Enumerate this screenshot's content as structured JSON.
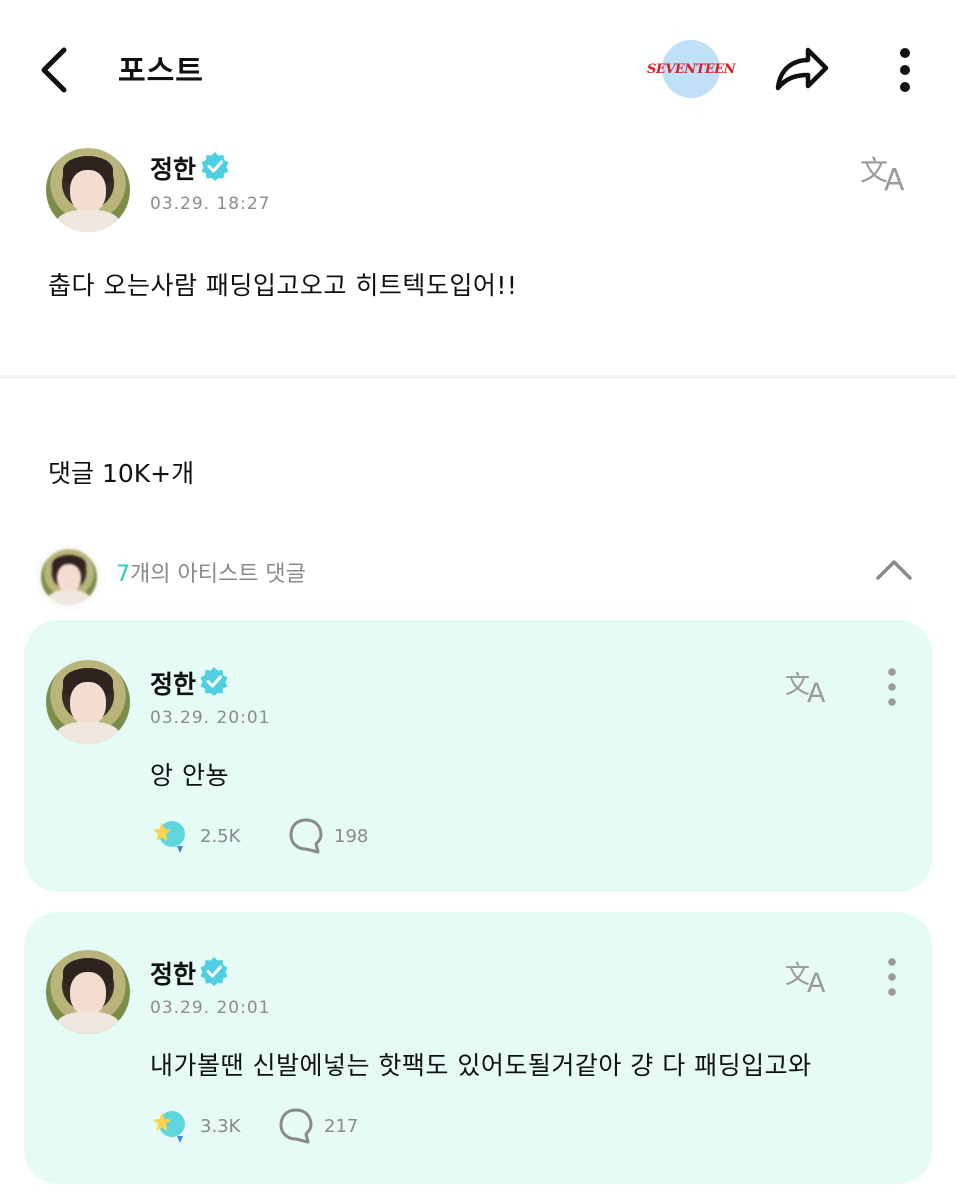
{
  "header": {
    "title": "포스트",
    "community_logo_text": "SEVENTEEN",
    "icons": {
      "back": "chevron-left-icon",
      "share": "share-arrow-icon",
      "more": "more-vertical-icon"
    }
  },
  "post": {
    "author": "정한",
    "timestamp": "03.29. 18:27",
    "body": "춥다 오는사람 패딩입고오고 히트텍도입어!!"
  },
  "comments_section": {
    "label": "댓글 10K+개",
    "artist_comments": {
      "count": "7",
      "suffix": "개의 아티스트 댓글"
    }
  },
  "comments": [
    {
      "author": "정한",
      "timestamp": "03.29. 20:01",
      "text": "앙 안뇽",
      "likes": "2.5K",
      "replies": "198"
    },
    {
      "author": "정한",
      "timestamp": "03.29. 20:01",
      "text": "내가볼땐 신발에넣는 핫팩도 있어도될거같아 걍 다 패딩입고와",
      "likes": "3.3K",
      "replies": "217"
    }
  ],
  "colors": {
    "accent": "#2ec8c0",
    "card_background": "#e6fbf6",
    "verified_badge": "#4fd0e2",
    "logo_text": "#d81d23"
  }
}
